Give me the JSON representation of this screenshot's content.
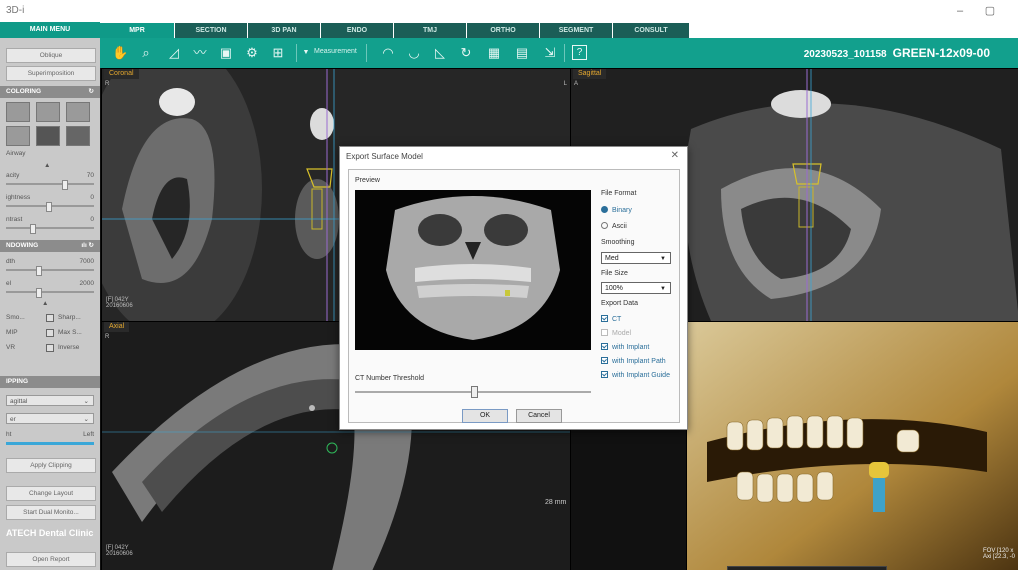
{
  "window": {
    "title": "3D-i",
    "minimize": "–",
    "restore": "▢"
  },
  "menu": {
    "main_menu": "MAIN MENU",
    "tabs": [
      {
        "label": "MPR",
        "active": true
      },
      {
        "label": "SECTION"
      },
      {
        "label": "3D PAN"
      },
      {
        "label": "ENDO"
      },
      {
        "label": "TMJ"
      },
      {
        "label": "ORTHO"
      },
      {
        "label": "SEGMENT"
      },
      {
        "label": "CONSULT"
      }
    ]
  },
  "toolbar": {
    "measurement_label": "Measurement",
    "patient_id": "20230523_101158",
    "patient_name": "GREEN-12x09-00",
    "help": "?"
  },
  "sidebar": {
    "oblique": "Oblique",
    "superimposition": "Superimposition",
    "coloring_header": "COLORING",
    "airway": "Airway",
    "opacity_label": "acity",
    "opacity_value": "70",
    "brightness_label": "ightness",
    "brightness_value": "0",
    "contrast_label": "ntrast",
    "contrast_value": "0",
    "windowing_header": "NDOWING",
    "width_label": "dth",
    "width_value": "7000",
    "level_label": "el",
    "level_value": "2000",
    "smooth": "Smo...",
    "sharp": "Sharp...",
    "mip": "MIP",
    "maxs": "Max S...",
    "vr": "VR",
    "inverse": "Inverse",
    "clipping_header": "IPPING",
    "clip_select": "agittal",
    "clip_select2": "er",
    "clip_side_left_label": "ht",
    "clip_side_right_label": "Left",
    "apply_clipping": "Apply Clipping",
    "change_layout": "Change Layout",
    "start_dual": "Start Dual Monito...",
    "clinic": "ATECH Dental Clinic",
    "open_report": "Open Report"
  },
  "viewports": {
    "coronal": {
      "label": "Coronal",
      "r": "R",
      "l": "L",
      "info": "[F] 042Y\n20160606"
    },
    "sagittal": {
      "label": "Sagittal",
      "a": "A"
    },
    "axial": {
      "label": "Axial",
      "r": "R",
      "info": "[F] 042Y\n20160606",
      "scale": "28 mm"
    },
    "render3d": {
      "info": "FOV [120 x\nAxi [22.3, -0"
    }
  },
  "dialog": {
    "title": "Export Surface Model",
    "close": "✕",
    "preview": "Preview",
    "ct_threshold": "CT Number Threshold",
    "ok": "OK",
    "cancel": "Cancel",
    "file_format": "File Format",
    "binary": "Binary",
    "ascii": "Ascii",
    "smoothing": "Smoothing",
    "smoothing_value": "Med",
    "file_size": "File Size",
    "file_size_value": "100%",
    "export_data": "Export Data",
    "ct": "CT",
    "model": "Model",
    "with_implant": "with Implant",
    "with_implant_path": "with Implant Path",
    "with_implant_guide": "with Implant Guide"
  },
  "colors": {
    "accent": "#12a08d",
    "tab_dark": "#1b5e57",
    "panel": "#c9c9c9",
    "crosshair": "#3aa7d8",
    "label": "#e3a72f"
  }
}
